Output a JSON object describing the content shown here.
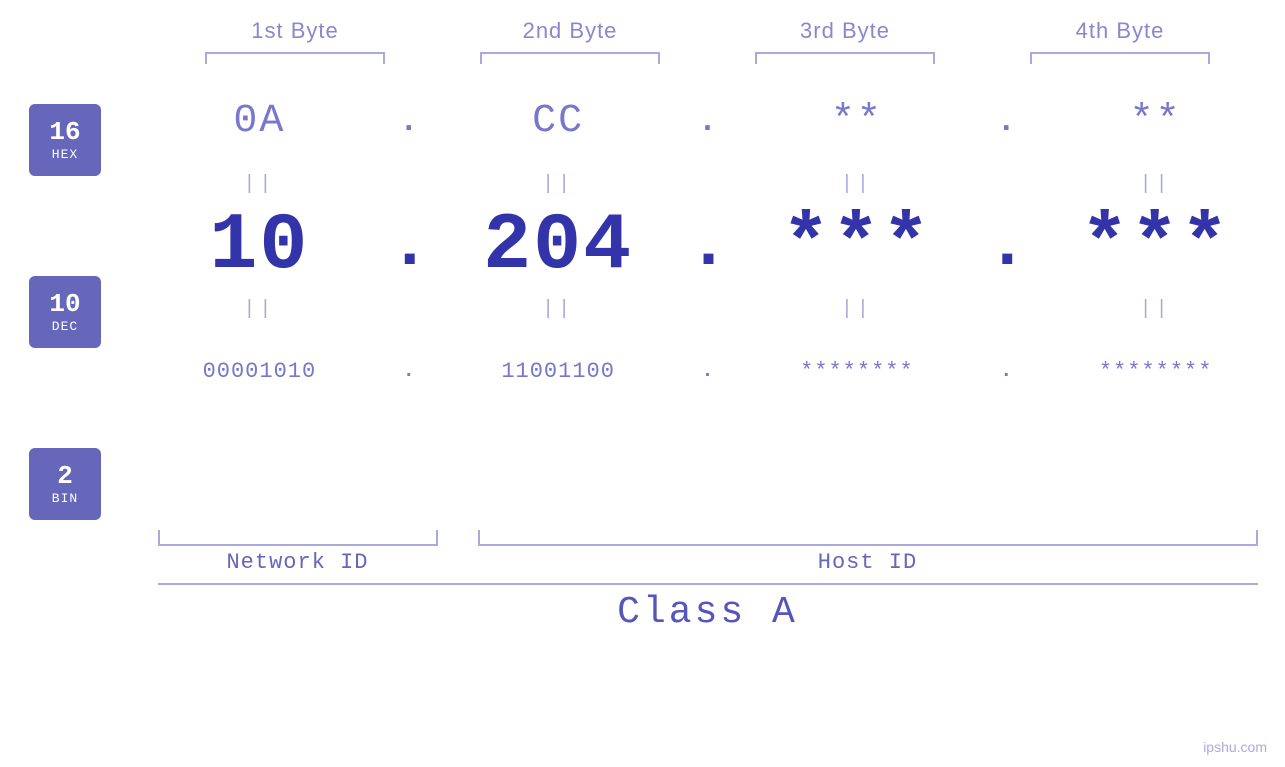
{
  "headers": {
    "byte1": "1st Byte",
    "byte2": "2nd Byte",
    "byte3": "3rd Byte",
    "byte4": "4th Byte"
  },
  "badges": [
    {
      "num": "16",
      "label": "HEX"
    },
    {
      "num": "10",
      "label": "DEC"
    },
    {
      "num": "2",
      "label": "BIN"
    }
  ],
  "hex_row": {
    "cells": [
      "0A",
      "CC",
      "**",
      "**"
    ],
    "dots": [
      ".",
      ".",
      "."
    ]
  },
  "dec_row": {
    "cells": [
      "10",
      "204",
      "***",
      "***"
    ],
    "dots": [
      ".",
      ".",
      "."
    ]
  },
  "bin_row": {
    "cells": [
      "00001010",
      "11001100",
      "********",
      "********"
    ],
    "dots": [
      ".",
      ".",
      "."
    ]
  },
  "equals": [
    "||",
    "||",
    "||",
    "||"
  ],
  "labels": {
    "network_id": "Network ID",
    "host_id": "Host ID",
    "class": "Class A"
  },
  "watermark": "ipshu.com"
}
